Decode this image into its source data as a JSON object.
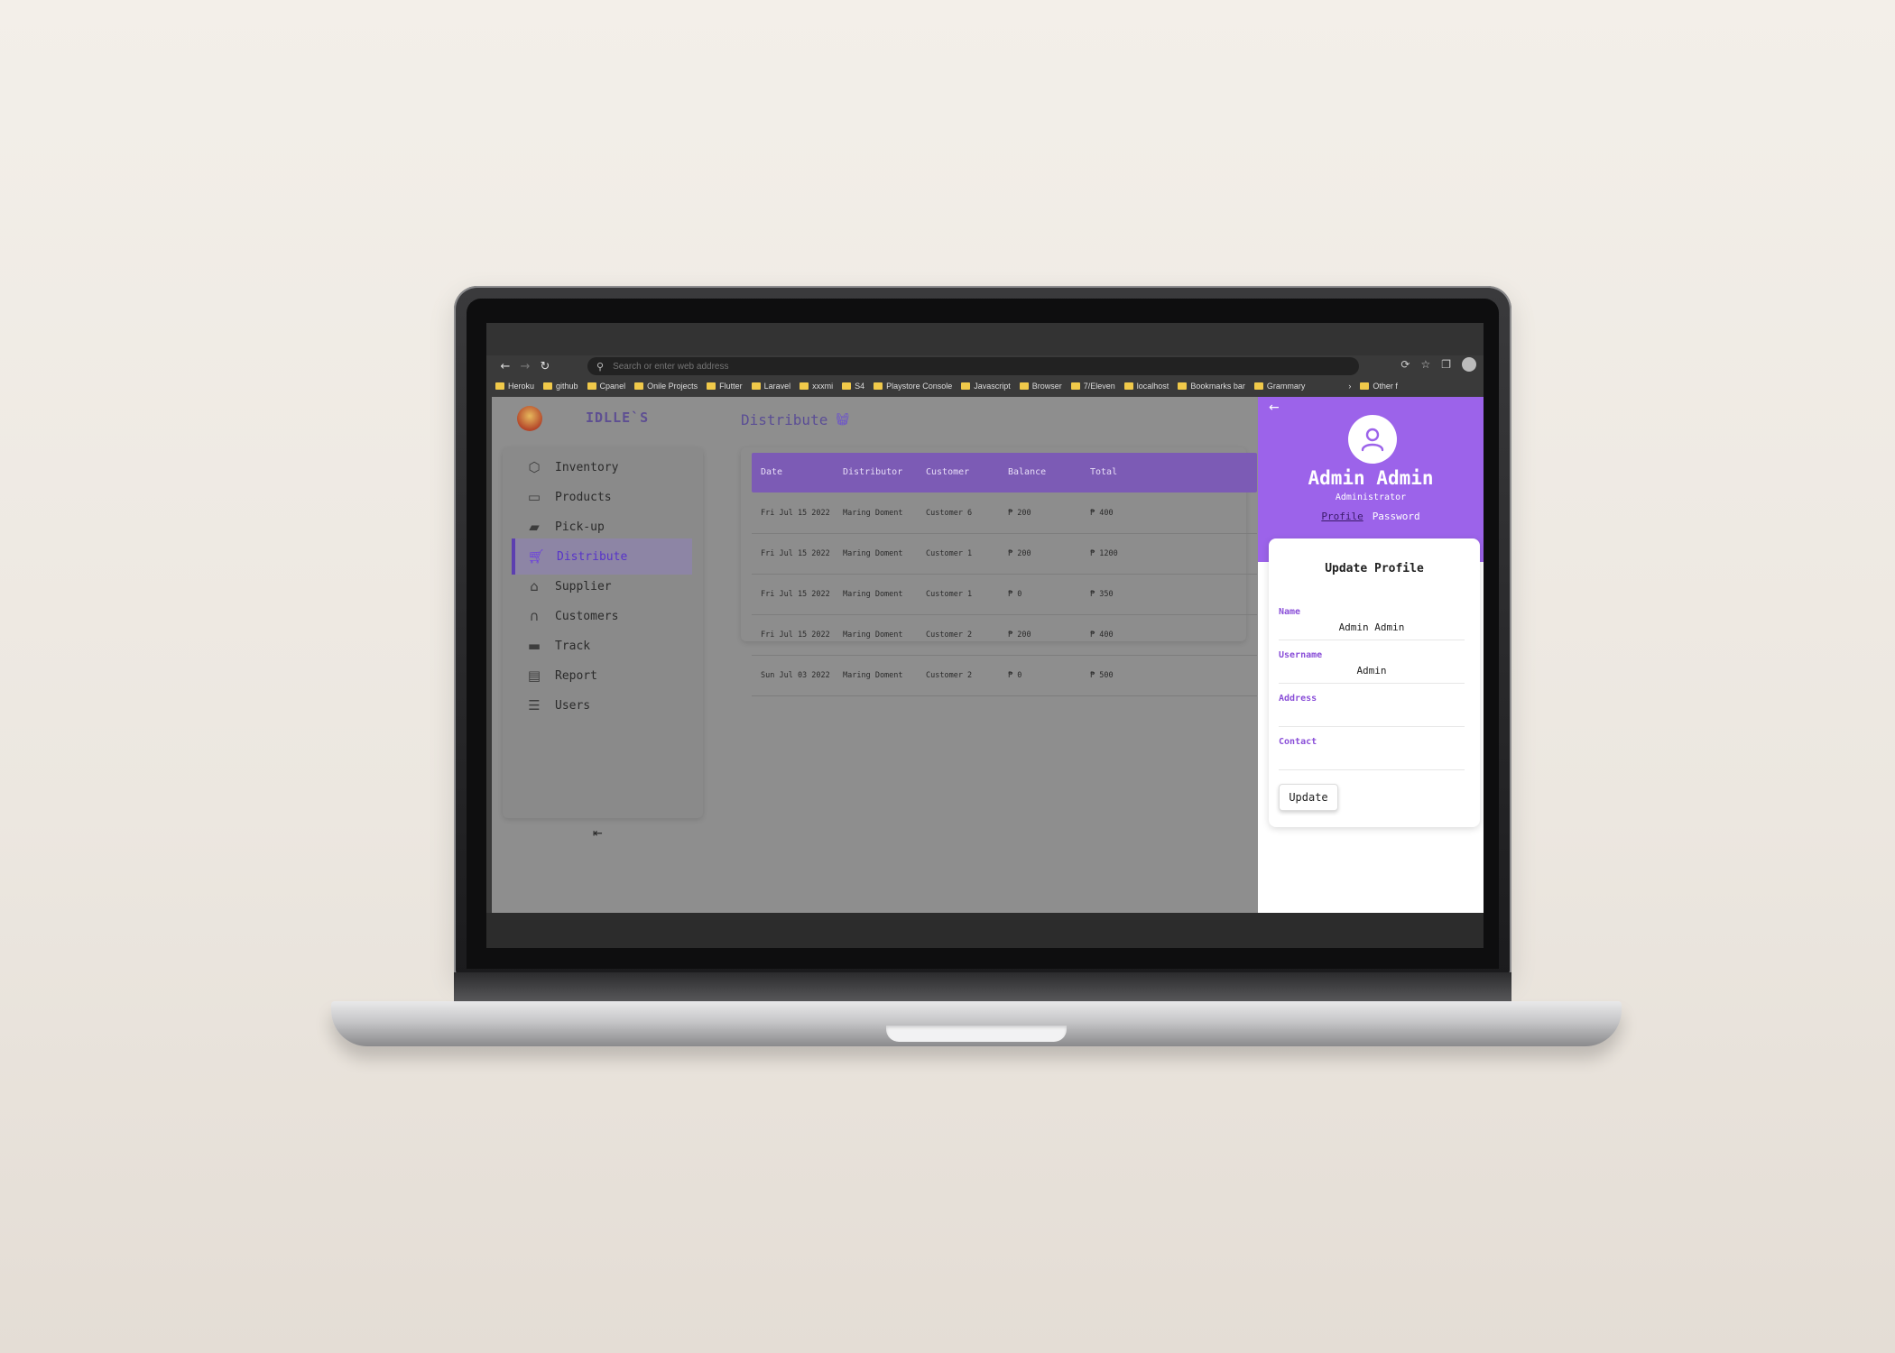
{
  "browser": {
    "address_placeholder": "Search or enter web address",
    "bookmarks": [
      "Heroku",
      "github",
      "Cpanel",
      "Onile Projects",
      "Flutter",
      "Laravel",
      "xxxmi",
      "S4",
      "Playstore Console",
      "Javascript",
      "Browser",
      "7/Eleven",
      "localhost",
      "Bookmarks bar",
      "Grammary"
    ],
    "other_bookmarks": "Other f"
  },
  "app": {
    "brand": "IDLLE`S",
    "page_title": "Distribute",
    "sidebar": [
      {
        "label": "Inventory",
        "icon": "box-icon",
        "active": false
      },
      {
        "label": "Products",
        "icon": "products-icon",
        "active": false
      },
      {
        "label": "Pick-up",
        "icon": "bag-icon",
        "active": false
      },
      {
        "label": "Distribute",
        "icon": "cart-icon",
        "active": true
      },
      {
        "label": "Supplier",
        "icon": "store-icon",
        "active": false
      },
      {
        "label": "Customers",
        "icon": "headset-icon",
        "active": false
      },
      {
        "label": "Track",
        "icon": "truck-icon",
        "active": false
      },
      {
        "label": "Report",
        "icon": "report-icon",
        "active": false
      },
      {
        "label": "Users",
        "icon": "users-icon",
        "active": false
      }
    ],
    "table": {
      "headers": [
        "Date",
        "Distributor",
        "Customer",
        "Balance",
        "Total"
      ],
      "rows": [
        [
          "Fri Jul 15 2022",
          "Maring Doment",
          "Customer 6",
          "₱ 200",
          "₱ 400"
        ],
        [
          "Fri Jul 15 2022",
          "Maring Doment",
          "Customer 1",
          "₱ 200",
          "₱ 1200"
        ],
        [
          "Fri Jul 15 2022",
          "Maring Doment",
          "Customer 1",
          "₱ 0",
          "₱ 350"
        ],
        [
          "Fri Jul 15 2022",
          "Maring Doment",
          "Customer 2",
          "₱ 200",
          "₱ 400"
        ],
        [
          "Sun Jul 03 2022",
          "Maring Doment",
          "Customer 2",
          "₱ 0",
          "₱ 500"
        ]
      ]
    }
  },
  "profile": {
    "name": "Admin Admin",
    "role": "Administrator",
    "tabs": {
      "profile": "Profile",
      "password": "Password"
    },
    "form": {
      "title": "Update Profile",
      "name_label": "Name",
      "name_value": "Admin Admin",
      "username_label": "Username",
      "username_value": "Admin",
      "address_label": "Address",
      "address_value": "",
      "contact_label": "Contact",
      "contact_value": "",
      "submit_label": "Update"
    }
  },
  "colors": {
    "accent": "#9c63ea",
    "table_header": "#7c5bb5",
    "active_item": "#5734c9"
  }
}
